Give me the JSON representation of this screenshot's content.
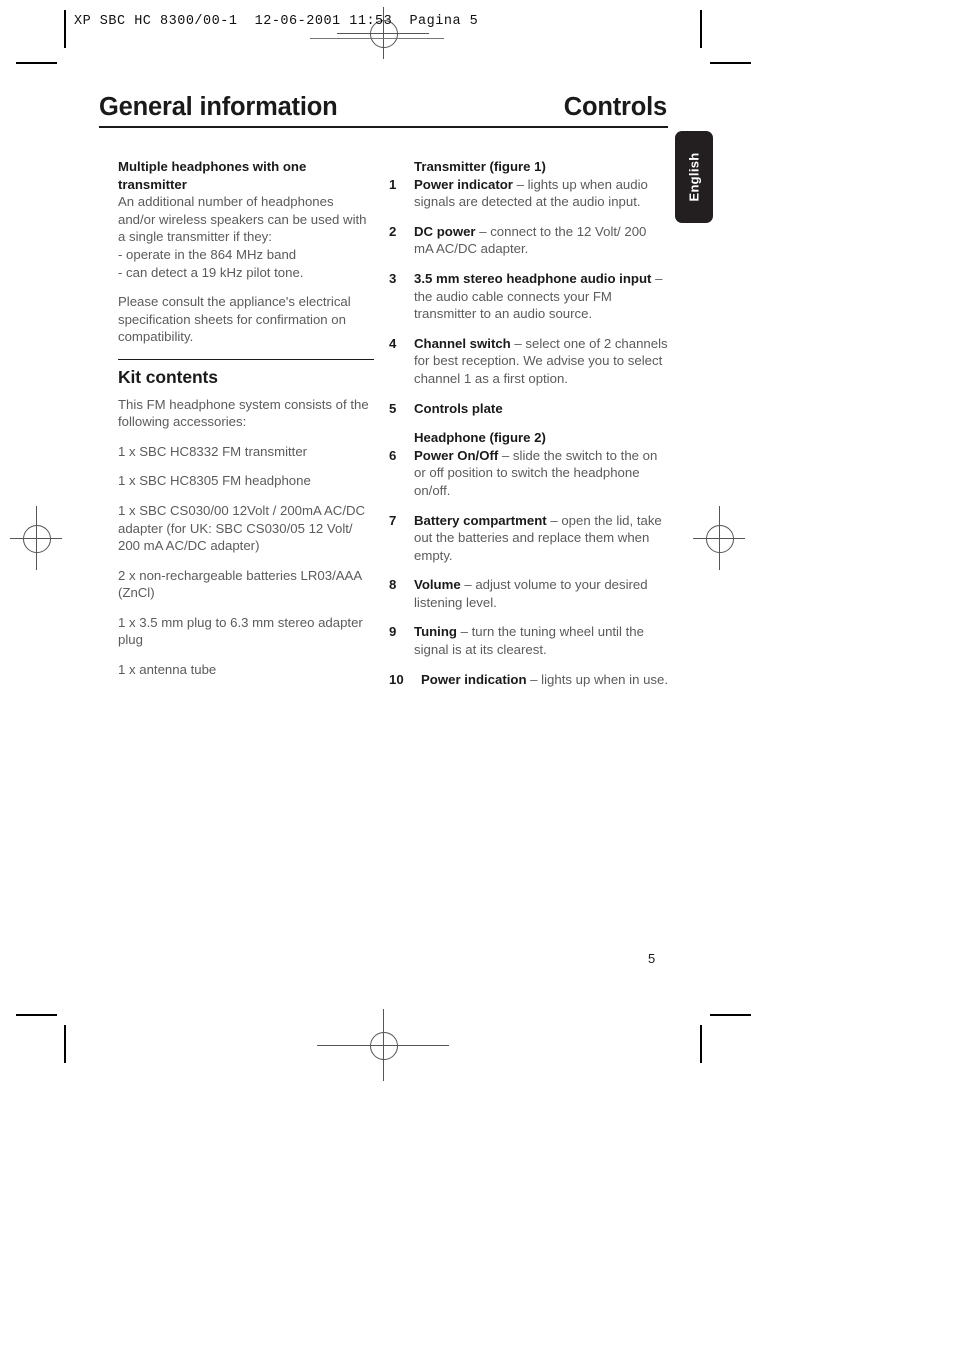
{
  "proof": {
    "header_line": "XP SBC HC 8300/00-1  12-06-2001 11:53  Pagina 5"
  },
  "page": {
    "title_left": "General information",
    "title_right": "Controls",
    "language_tab": "English",
    "folio": "5"
  },
  "left_column": {
    "multiple_headphones": {
      "heading_line1": "Multiple headphones with one",
      "heading_line2": "transmitter",
      "paragraph": "An additional number of headphones and/or wireless speakers can be used with a single transmitter if they:",
      "bullet_1": "- operate in the 864 MHz band",
      "bullet_2": "- can detect a 19 kHz pilot tone.",
      "note": "Please consult the appliance's electrical specification sheets for confirmation on compatibility."
    },
    "kit_contents": {
      "heading": "Kit contents",
      "intro": "This FM headphone system consists of the following accessories:",
      "items": [
        "1 x SBC HC8332 FM transmitter",
        "1 x SBC HC8305 FM headphone",
        "1 x SBC CS030/00 12Volt / 200mA AC/DC adapter (for UK: SBC CS030/05 12 Volt/ 200 mA AC/DC adapter)",
        "2 x non-rechargeable batteries LR03/AAA (ZnCl)",
        "1 x 3.5 mm plug to 6.3 mm stereo adapter plug",
        "1 x antenna tube"
      ]
    }
  },
  "right_column": {
    "transmitter_heading": "Transmitter (figure 1)",
    "headphone_heading": "Headphone (figure 2)",
    "items": [
      {
        "num": "1",
        "term": "Power indicator",
        "desc": " – lights up when audio signals are detected at the audio input."
      },
      {
        "num": "2",
        "term": "DC power",
        "desc": " – connect to the 12 Volt/ 200 mA AC/DC adapter."
      },
      {
        "num": "3",
        "term": "3.5 mm stereo headphone audio input",
        "desc": " – the audio cable connects your FM transmitter to an audio source."
      },
      {
        "num": "4",
        "term": "Channel switch",
        "desc": " – select one of 2 channels for best reception. We advise you to select channel 1 as a first option."
      },
      {
        "num": "5",
        "term": "Controls plate",
        "desc": ""
      },
      {
        "num": "6",
        "term": "Power On/Off",
        "desc": " – slide the switch to the on or off position to switch the headphone on/off."
      },
      {
        "num": "7",
        "term": "Battery compartment",
        "desc": " – open the lid, take out the batteries and replace them when empty."
      },
      {
        "num": "8",
        "term": "Volume",
        "desc": " – adjust volume to your desired listening level."
      },
      {
        "num": "9",
        "term": "Tuning",
        "desc": " – turn the tuning wheel until the signal is at its clearest."
      },
      {
        "num": "10",
        "term": "Power indication",
        "desc": " – lights up when in use."
      }
    ]
  }
}
